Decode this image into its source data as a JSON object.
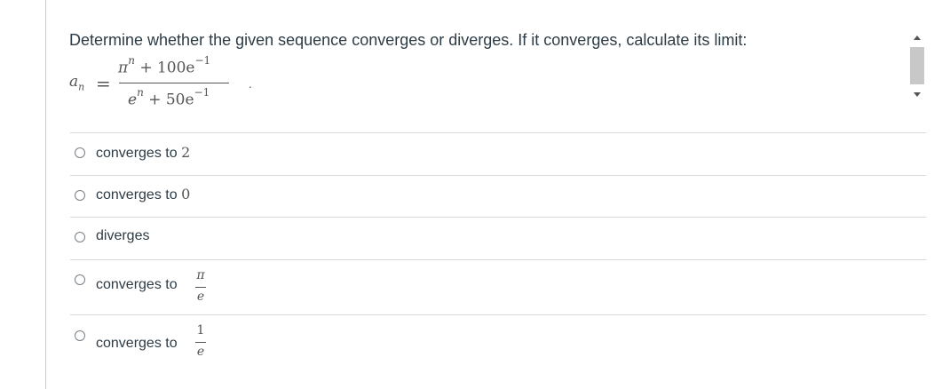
{
  "question": {
    "text": "Determine whether the given sequence converges or diverges. If it converges, calculate its limit:"
  },
  "formula": {
    "lhs": "a",
    "lhs_sub": "n",
    "equals": "=",
    "numerator_base": "π",
    "numerator_exp": "n",
    "numerator_rest": " + 100e",
    "numerator_rest_exp": "−1",
    "denominator_base": "e",
    "denominator_exp": "n",
    "denominator_rest": " + 50e",
    "denominator_rest_exp": "−1",
    "trailing": "."
  },
  "options": [
    {
      "label": "converges to",
      "value": "2"
    },
    {
      "label": "converges to",
      "value": "0"
    },
    {
      "label": "diverges",
      "value": ""
    },
    {
      "label": "converges to",
      "frac_num": "π",
      "frac_den": "e"
    },
    {
      "label": "converges to",
      "frac_num": "1",
      "frac_den": "e"
    }
  ]
}
